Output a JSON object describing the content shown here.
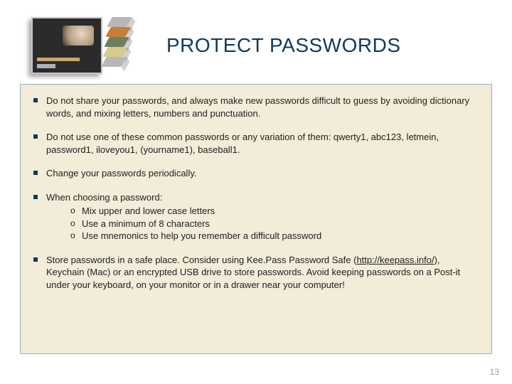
{
  "slide": {
    "title": "PROTECT PASSWORDS",
    "page_number": "13",
    "image_alt": "password-photo",
    "icon": "stacked-cubes-icon"
  },
  "bullets": {
    "b1": "Do not share your passwords, and always make new passwords difficult to guess by avoiding dictionary words, and mixing letters, numbers and punctuation.",
    "b2": "Do not use one of these common passwords or any variation of them: qwerty1, abc123, letmein, password1, iloveyou1, (yourname1), baseball1.",
    "b3": "Change your passwords periodically.",
    "b4_lead": "When choosing a password:",
    "b4_sub": {
      "s1": "Mix upper and lower case letters",
      "s2": "Use a minimum of 8 characters",
      "s3": "Use mnemonics to help you remember a difficult password"
    },
    "b5_pre": "Store passwords in a safe place. Consider using Kee.Pass Password Safe (",
    "b5_link": "http://keepass.info/",
    "b5_post": "), Keychain (Mac) or an encrypted USB drive to store passwords. Avoid keeping passwords on a Post-it under your keyboard, on your monitor or in a drawer near your computer!"
  }
}
